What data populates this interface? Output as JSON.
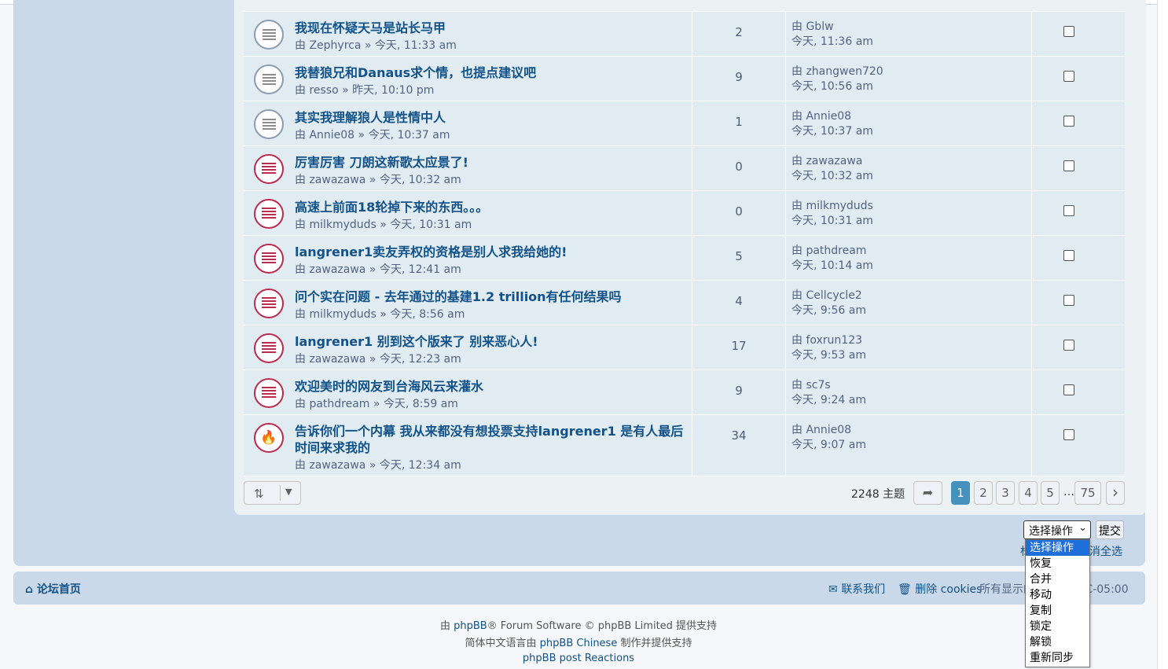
{
  "topics": [
    {
      "title": "我现在怀疑天马是站长马甲",
      "author": "Zephyrca",
      "time": "今天, 11:33 am",
      "replies": "2",
      "last_author": "Gblw",
      "last_time": "今天, 11:36 am",
      "icon": "read"
    },
    {
      "title": "我替狼兄和Danaus求个情，也提点建议吧",
      "author": "resso",
      "time": "昨天, 10:10 pm",
      "replies": "9",
      "last_author": "zhangwen720",
      "last_time": "今天, 10:56 am",
      "icon": "read"
    },
    {
      "title": "其实我理解狼人是性情中人",
      "author": "Annie08",
      "time": "今天, 10:37 am",
      "replies": "1",
      "last_author": "Annie08",
      "last_time": "今天, 10:37 am",
      "icon": "read"
    },
    {
      "title": "厉害厉害 刀朗这新歌太应景了!",
      "author": "zawazawa",
      "time": "今天, 10:32 am",
      "replies": "0",
      "last_author": "zawazawa",
      "last_time": "今天, 10:32 am",
      "icon": "unread"
    },
    {
      "title": "高速上前面18轮掉下来的东西。。。",
      "author": "milkmyduds",
      "time": "今天, 10:31 am",
      "replies": "0",
      "last_author": "milkmyduds",
      "last_time": "今天, 10:31 am",
      "icon": "unread"
    },
    {
      "title": "langrener1卖友弄权的资格是别人求我给她的!",
      "author": "zawazawa",
      "time": "今天, 12:41 am",
      "replies": "5",
      "last_author": "pathdream",
      "last_time": "今天, 10:14 am",
      "icon": "unread"
    },
    {
      "title": "问个实在问题 - 去年通过的基建1.2 trillion有任何结果吗",
      "author": "milkmyduds",
      "time": "今天, 8:56 am",
      "replies": "4",
      "last_author": "Cellcycle2",
      "last_time": "今天, 9:56 am",
      "icon": "unread"
    },
    {
      "title": "langrener1 别到这个版来了 别来恶心人!",
      "author": "zawazawa",
      "time": "今天, 12:23 am",
      "replies": "17",
      "last_author": "foxrun123",
      "last_time": "今天, 9:53 am",
      "icon": "unread"
    },
    {
      "title": "欢迎美时的网友到台海风云来灌水",
      "author": "pathdream",
      "time": "今天, 8:59 am",
      "replies": "9",
      "last_author": "sc7s",
      "last_time": "今天, 9:24 am",
      "icon": "unread"
    },
    {
      "title": "告诉你们一个内幕 我从来都没有想投票支持langrener1 是有人最后时间来求我的",
      "author": "zawazawa",
      "time": "今天, 12:34 am",
      "replies": "34",
      "last_author": "Annie08",
      "last_time": "今天, 9:07 am",
      "icon": "hot"
    }
  ],
  "by_prefix": "由",
  "sep": "»",
  "pagination": {
    "topics_count": "2248 主题",
    "pages": [
      "1",
      "2",
      "3",
      "4",
      "5",
      "75"
    ],
    "ellipsis": "…",
    "current": "1"
  },
  "moderation": {
    "select_value": "选择操作",
    "submit_label": "提交",
    "options": [
      "选择操作",
      "恢复",
      "合并",
      "移动",
      "复制",
      "锁定",
      "解锁",
      "重新同步"
    ],
    "mark_all_partial": "标",
    "unmark_all": "消全选"
  },
  "footer": {
    "home": "论坛首页",
    "contact": "联系我们",
    "delete_cookies": "删除 cookies",
    "timezone": "所有显示的时间为 UTC-05:00",
    "line1_pre": "由 ",
    "line1_link": "phpBB",
    "line1_post": "® Forum Software © phpBB Limited 提供支持",
    "line2_pre": "简体中文语言由 ",
    "line2_link": "phpBB Chinese",
    "line2_post": " 制作并提供支持",
    "line3_link": "phpBB post Reactions"
  },
  "colors": {
    "unread": "#bc2a4d",
    "read": "#8a9bb3",
    "link": "#105289",
    "active_page": "#4692bf"
  }
}
